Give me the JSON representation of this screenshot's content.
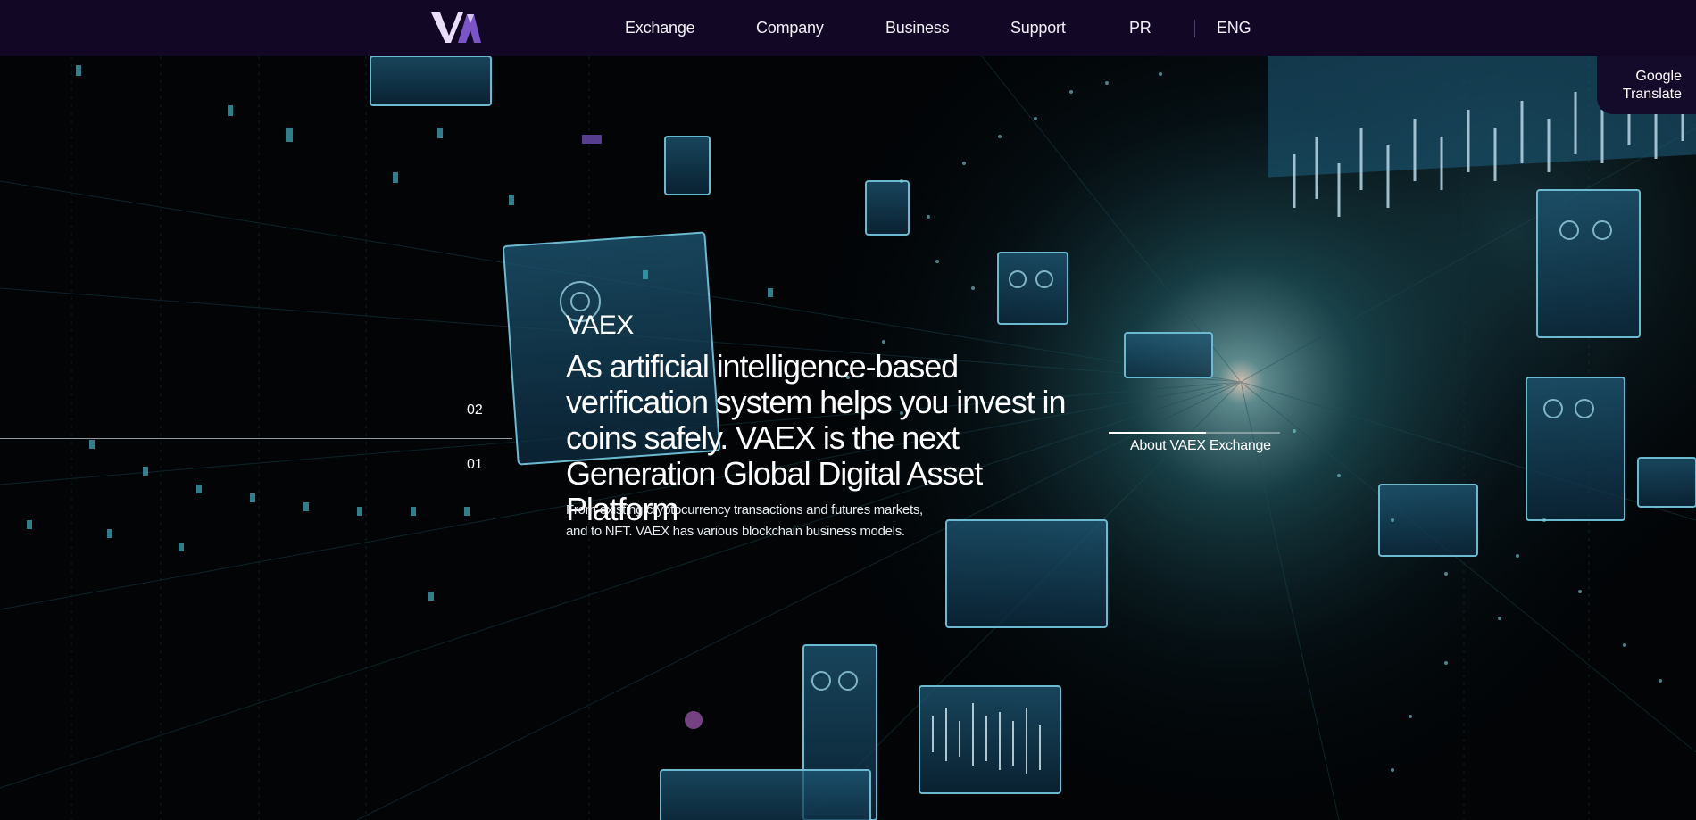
{
  "header": {
    "logo_text": "VA",
    "nav": [
      {
        "label": "Exchange"
      },
      {
        "label": "Company"
      },
      {
        "label": "Business"
      },
      {
        "label": "Support"
      },
      {
        "label": "PR"
      }
    ],
    "language": "ENG"
  },
  "translate_tab": {
    "line1": "Google",
    "line2": "Translate"
  },
  "slider": {
    "upper_index": "02",
    "lower_index": "01"
  },
  "hero": {
    "brand": "VAEX",
    "headline": "As artificial intelligence-based verification system helps you invest in coins safely. VAEX is the next Generation Global Digital Asset Platform",
    "subtext": "From existing cryptocurrency transactions and futures markets, and to NFT. VAEX has various blockchain business models.",
    "about_link": "About VAEX Exchange"
  },
  "colors": {
    "header_bg": "#120826",
    "logo_light": "#e9ddf7",
    "logo_accent": "#7a55c8",
    "background": "#020406",
    "glow": "#5fb9c4"
  }
}
